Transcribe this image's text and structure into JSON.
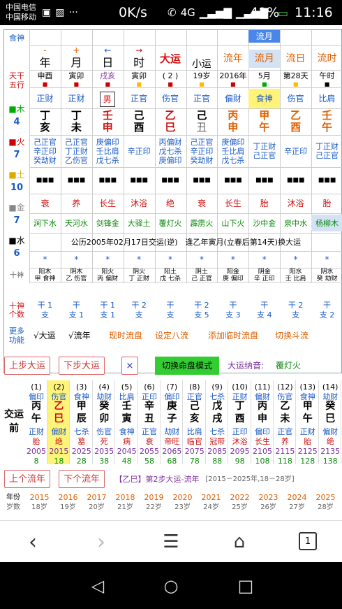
{
  "status": {
    "carrier1": "中国电信",
    "carrier2": "中国移动",
    "speed": "0K/s",
    "net": "4G",
    "battery": "41%",
    "time": "11:16"
  },
  "top": {
    "label_shishen": "食神",
    "liuyue_tag": "流月",
    "cols": [
      {
        "sign": "-",
        "name": "年",
        "stem_branch": "申酉"
      },
      {
        "sign": "+",
        "name": "月",
        "stem_branch": "寅卯"
      },
      {
        "sign": "←",
        "name": "日",
        "stem_branch": "戌亥"
      },
      {
        "sign": "→",
        "name": "时",
        "stem_branch": "寅卯"
      },
      {
        "sign": "",
        "name": "大运",
        "stem_branch": "( 2 )"
      },
      {
        "sign": "",
        "name": "小运",
        "stem_branch": "19岁"
      },
      {
        "sign": "",
        "name": "流年",
        "stem_branch": "2016年"
      },
      {
        "sign": "",
        "name": "流月",
        "stem_branch": "5月"
      },
      {
        "sign": "",
        "name": "流日",
        "stem_branch": "第28天"
      },
      {
        "sign": "",
        "name": "流时",
        "stem_branch": "午时"
      }
    ],
    "tiangan_label": "天干",
    "wuxing_label": "五行",
    "shishen": [
      "正财",
      "正财",
      "男",
      "正官",
      "伤官",
      "正官",
      "偏财",
      "食神",
      "伤官",
      "比肩"
    ],
    "gan": [
      "丁",
      "丁",
      "壬",
      "己",
      "乙",
      "己",
      "丙",
      "甲",
      "乙",
      "壬"
    ],
    "zhi": [
      "亥",
      "未",
      "申",
      "酉",
      "巳",
      "丑",
      "申",
      "午",
      "酉",
      "午"
    ],
    "canggan": [
      "己正官\n辛正印\n癸劫财",
      "己正官\n丁正财\n乙伤官",
      "庚偏印\n壬比肩\n戊七杀",
      "辛正印",
      "丙偏财\n戊七杀\n庚偏印",
      "己正官\n辛正印\n癸劫财",
      "庚偏印\n壬比肩\n戊七杀",
      "丁正财\n己正官",
      "辛正印",
      "丁正财\n己正官"
    ],
    "changsheng": [
      "衰",
      "养",
      "长生",
      "沐浴",
      "绝",
      "衰",
      "长生",
      "胎",
      "沐浴",
      "胎"
    ],
    "nayin": [
      "涧下水",
      "天河水",
      "剑锋金",
      "大驿土",
      "覆灯火",
      "霹雳火",
      "山下火",
      "沙中金",
      "泉中水",
      "杨柳木"
    ],
    "wuxing_side": [
      {
        "el": "木",
        "n": "4"
      },
      {
        "el": "火",
        "n": "7"
      },
      {
        "el": "土",
        "n": "10"
      },
      {
        "el": "金",
        "n": "7"
      },
      {
        "el": "水",
        "n": "6"
      }
    ],
    "birth_note": "公历2005年02月17日交运(逆)　逢乙年寅月(立春后第14天)换大运",
    "stars": [
      "*",
      "*",
      "*",
      "*",
      "*",
      "*",
      "*",
      "*",
      "*",
      "*"
    ],
    "shishen2_label": "十神",
    "shishen2": [
      "阳木\n甲 食神",
      "阴木\n乙 伤官",
      "阳火\n丙 偏财",
      "阴火\n丁 正财",
      "阳土\n戊 七杀",
      "阴土\n己 正官",
      "阳金\n庚 偏印",
      "阴金\n辛 正印",
      "阳水\n壬 比肩",
      "阴水\n癸 劫财"
    ],
    "count_label": "十神\n个数",
    "counts": [
      "干 1\n支",
      "干\n支 1",
      "干 1\n支 1",
      "干 2\n支",
      "干\n支",
      "干 2\n支 5",
      "干\n支 3",
      "干\n支 4",
      "干 2\n支",
      "干\n支 2"
    ],
    "more_label": "更多\n功能",
    "more_items": [
      "√大运",
      "√流年",
      "现时流盘",
      "设定八流",
      "添加临时流盘",
      "切换斗流"
    ]
  },
  "dayun": {
    "btn_prev": "上步大运",
    "btn_next": "下步大运",
    "btn_close": "×",
    "btn_mode": "切换命盘模式",
    "nayin_label": "大运纳音:",
    "nayin_val": "覆灯火",
    "left_label": "交运前",
    "cols": [
      {
        "n": "(1)",
        "ss": "偏印",
        "g": "丙",
        "z": "午",
        "zs": "正财",
        "cs": "胎",
        "y": "2005",
        "a": "8"
      },
      {
        "n": "(2)",
        "ss": "伤官",
        "g": "乙",
        "z": "巳",
        "zs": "偏财",
        "cs": "绝",
        "y": "2015",
        "a": "18"
      },
      {
        "n": "(3)",
        "ss": "食神",
        "g": "甲",
        "z": "辰",
        "zs": "七杀",
        "cs": "墓",
        "y": "2025",
        "a": "28"
      },
      {
        "n": "(4)",
        "ss": "劫财",
        "g": "癸",
        "z": "卯",
        "zs": "伤官",
        "cs": "死",
        "y": "2035",
        "a": "38"
      },
      {
        "n": "(5)",
        "ss": "比肩",
        "g": "壬",
        "z": "寅",
        "zs": "食神",
        "cs": "病",
        "y": "2045",
        "a": "48"
      },
      {
        "n": "(6)",
        "ss": "正印",
        "g": "辛",
        "z": "丑",
        "zs": "正官",
        "cs": "衰",
        "y": "2055",
        "a": "58"
      },
      {
        "n": "(7)",
        "ss": "偏印",
        "g": "庚",
        "z": "子",
        "zs": "劫财",
        "cs": "帝旺",
        "y": "2065",
        "a": "68"
      },
      {
        "n": "(8)",
        "ss": "正官",
        "g": "己",
        "z": "亥",
        "zs": "比肩",
        "cs": "临官",
        "y": "2075",
        "a": "78"
      },
      {
        "n": "(9)",
        "ss": "七杀",
        "g": "戊",
        "z": "戌",
        "zs": "七杀",
        "cs": "冠带",
        "y": "2085",
        "a": "88"
      },
      {
        "n": "(10)",
        "ss": "正财",
        "g": "丁",
        "z": "酉",
        "zs": "正印",
        "cs": "沐浴",
        "y": "2095",
        "a": "98"
      },
      {
        "n": "(11)",
        "ss": "偏财",
        "g": "丙",
        "z": "申",
        "zs": "偏印",
        "cs": "长生",
        "y": "2105",
        "a": "108"
      },
      {
        "n": "(12)",
        "ss": "伤官",
        "g": "乙",
        "z": "未",
        "zs": "正官",
        "cs": "养",
        "y": "2115",
        "a": "118"
      },
      {
        "n": "(13)",
        "ss": "食神",
        "g": "甲",
        "z": "午",
        "zs": "正财",
        "cs": "胎",
        "y": "2125",
        "a": "128"
      },
      {
        "n": "(14)",
        "ss": "劫财",
        "g": "癸",
        "z": "巳",
        "zs": "偏财",
        "cs": "绝",
        "y": "2135",
        "a": "138"
      }
    ]
  },
  "liunian": {
    "btn_prev": "上个流年",
    "btn_next": "下个流年",
    "title": "【乙巳】第2步大运-流年",
    "range": "[2015－2025年,18－28岁]",
    "row_label1": "年份",
    "row_label2": "岁数",
    "years": [
      {
        "y": "2015",
        "a": "18岁"
      },
      {
        "y": "2016",
        "a": "19岁"
      },
      {
        "y": "2017",
        "a": "20岁"
      },
      {
        "y": "2018",
        "a": "21岁"
      },
      {
        "y": "2019",
        "a": "22岁"
      },
      {
        "y": "2020",
        "a": "23岁"
      },
      {
        "y": "2021",
        "a": "24岁"
      },
      {
        "y": "2022",
        "a": "25岁"
      },
      {
        "y": "2023",
        "a": "26岁"
      },
      {
        "y": "2024",
        "a": "27岁"
      },
      {
        "y": "2025",
        "a": "28岁"
      }
    ]
  },
  "browser": {
    "tab_count": "1"
  }
}
